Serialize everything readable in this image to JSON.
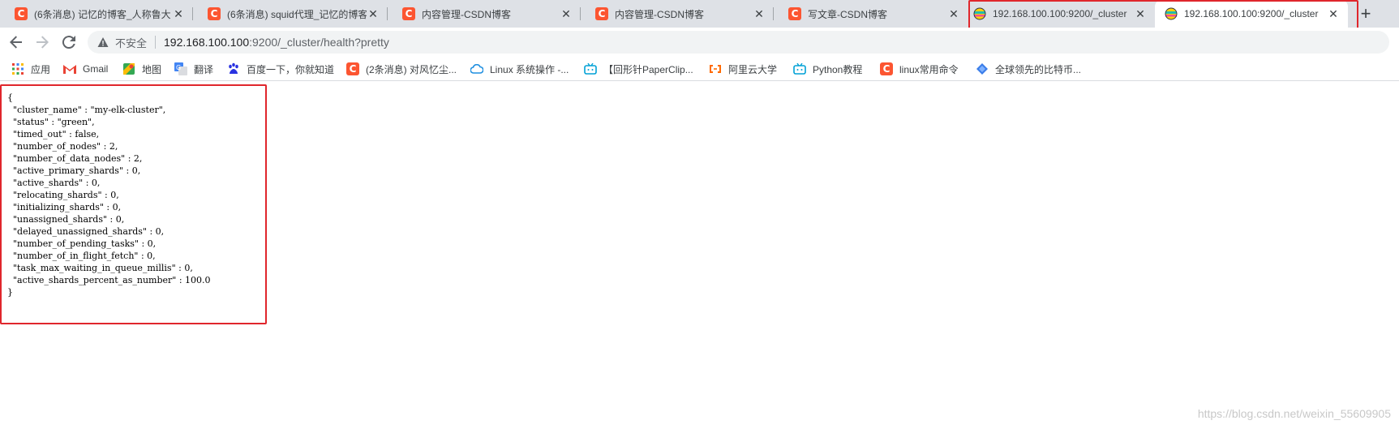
{
  "tabs": [
    {
      "title": "(6条消息) 记忆的博客_人称鲁大",
      "favicon": "csdn-icon"
    },
    {
      "title": "(6条消息) squid代理_记忆的博客",
      "favicon": "csdn-icon"
    },
    {
      "title": "内容管理-CSDN博客",
      "favicon": "csdn-icon"
    },
    {
      "title": "内容管理-CSDN博客",
      "favicon": "csdn-icon"
    },
    {
      "title": "写文章-CSDN博客",
      "favicon": "csdn-icon"
    },
    {
      "title": "192.168.100.100:9200/_cluster",
      "favicon": "elastic-icon"
    },
    {
      "title": "192.168.100.100:9200/_cluster",
      "favicon": "elastic-icon",
      "active": true
    }
  ],
  "toolbar": {
    "security_label": "不安全",
    "url_host": "192.168.100.100",
    "url_rest": ":9200/_cluster/health?pretty"
  },
  "bookmarks": [
    {
      "label": "应用",
      "icon": "apps-grid-icon"
    },
    {
      "label": "Gmail",
      "icon": "gmail-icon"
    },
    {
      "label": "地图",
      "icon": "maps-icon"
    },
    {
      "label": "翻译",
      "icon": "translate-icon"
    },
    {
      "label": "百度一下，你就知道",
      "icon": "baidu-icon"
    },
    {
      "label": "(2条消息) 对风忆尘...",
      "icon": "csdn-icon"
    },
    {
      "label": "Linux 系统操作 -...",
      "icon": "cloud-icon"
    },
    {
      "label": "【回形针PaperClip...",
      "icon": "bilibili-icon"
    },
    {
      "label": "阿里云大学",
      "icon": "aliyun-icon"
    },
    {
      "label": "Python教程",
      "icon": "bilibili-icon"
    },
    {
      "label": "linux常用命令",
      "icon": "csdn-icon"
    },
    {
      "label": "全球领先的比特币...",
      "icon": "gem-icon"
    }
  ],
  "json_lines": [
    "{",
    "  \"cluster_name\" : \"my-elk-cluster\",",
    "  \"status\" : \"green\",",
    "  \"timed_out\" : false,",
    "  \"number_of_nodes\" : 2,",
    "  \"number_of_data_nodes\" : 2,",
    "  \"active_primary_shards\" : 0,",
    "  \"active_shards\" : 0,",
    "  \"relocating_shards\" : 0,",
    "  \"initializing_shards\" : 0,",
    "  \"unassigned_shards\" : 0,",
    "  \"delayed_unassigned_shards\" : 0,",
    "  \"number_of_pending_tasks\" : 0,",
    "  \"number_of_in_flight_fetch\" : 0,",
    "  \"task_max_waiting_in_queue_millis\" : 0,",
    "  \"active_shards_percent_as_number\" : 100.0",
    "}"
  ],
  "watermark": "https://blog.csdn.net/weixin_55609905",
  "colors": {
    "highlight": "#e0262c",
    "csdn": "#fc5531"
  }
}
